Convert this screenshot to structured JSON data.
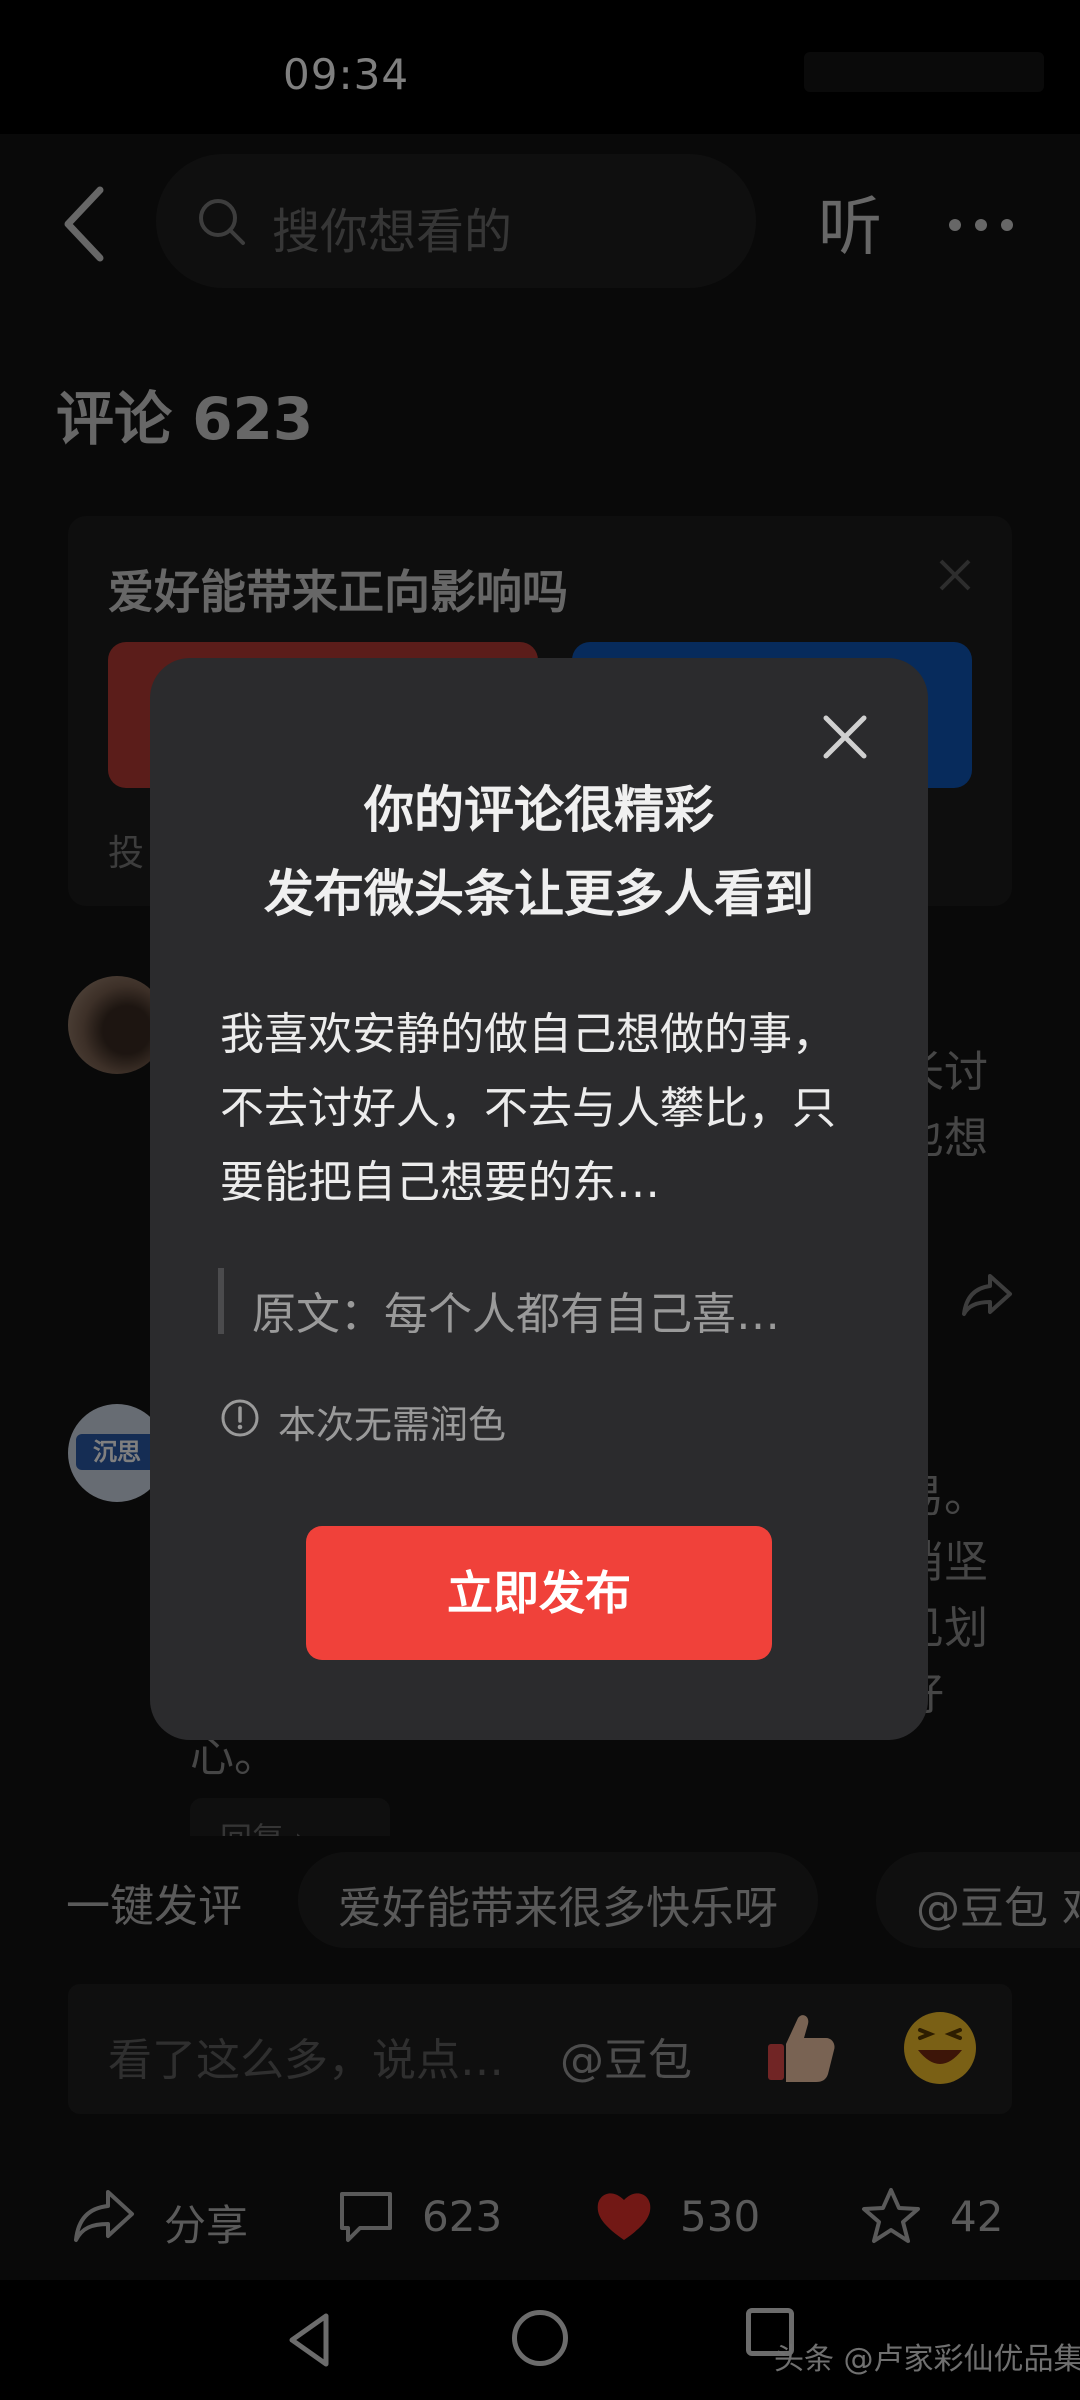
{
  "status_bar": {
    "time": "09:34"
  },
  "header": {
    "search_placeholder": "搜你想看的",
    "listen_label": "听"
  },
  "comments": {
    "title": "评论 623",
    "fragments": [
      "长讨\n也想",
      "易。\n消坚\n见划\n好",
      "心。"
    ],
    "reply_label": "回复 ›"
  },
  "poll": {
    "question": "爱好能带来正向影响吗",
    "footer": "投"
  },
  "dialog": {
    "title_line1": "你的评论很精彩",
    "title_line2": "发布微头条让更多人看到",
    "body": "我喜欢安静的做自己想做的事，不去讨好人，不去与人攀比，只要能把自己想要的东…",
    "quote": "原文：每个人都有自己喜…",
    "polish_note": "本次无需润色",
    "publish_button": "立即发布"
  },
  "quick_comment": {
    "label": "一键发评",
    "chips": [
      "爱好能带来很多快乐呀",
      "@豆包 鸡"
    ]
  },
  "input": {
    "placeholder": "看了这么多，说点…",
    "mention": "@豆包"
  },
  "actions": {
    "share": "分享",
    "comments": "623",
    "likes": "530",
    "favorites": "42"
  },
  "watermark": "头条 @卢家彩仙优品集",
  "colors": {
    "accent_red": "#f0413a",
    "poll_red": "#b63a34",
    "poll_blue": "#0f56b8",
    "heart_red": "#e5302b",
    "dialog_bg": "#2b2b2d"
  },
  "icons": [
    "back-icon",
    "search-icon",
    "more-icon",
    "close-icon",
    "share-icon",
    "comment-icon",
    "heart-icon",
    "star-icon",
    "thumbs-up-icon",
    "laugh-emoji-icon",
    "info-icon"
  ]
}
